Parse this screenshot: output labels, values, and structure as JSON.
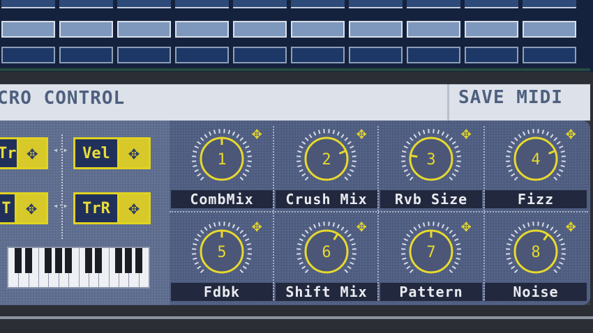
{
  "header": {
    "title": "CRO CONTROL",
    "save_label": "SAVE MIDI"
  },
  "modulators": [
    {
      "label": "Tr"
    },
    {
      "label": "Vel"
    },
    {
      "label": "T"
    },
    {
      "label": "TrR"
    }
  ],
  "knobs": [
    {
      "number": "1",
      "label": "CombMix",
      "value": 0.5
    },
    {
      "number": "2",
      "label": "Crush Mix",
      "value": 0.75
    },
    {
      "number": "3",
      "label": "Rvb Size",
      "value": 0.2
    },
    {
      "number": "4",
      "label": "Fizz",
      "value": 0.75
    },
    {
      "number": "5",
      "label": "Fdbk",
      "value": 0.5
    },
    {
      "number": "6",
      "label": "Shift Mix",
      "value": 0.62
    },
    {
      "number": "7",
      "label": "Pattern",
      "value": 0.5
    },
    {
      "number": "8",
      "label": "Noise",
      "value": 0.63
    }
  ],
  "icons": {
    "move": "four-way-arrow-icon"
  },
  "colors": {
    "accent": "#e9de3a",
    "panel": "#4e5c80",
    "header_text": "#4e607e"
  }
}
